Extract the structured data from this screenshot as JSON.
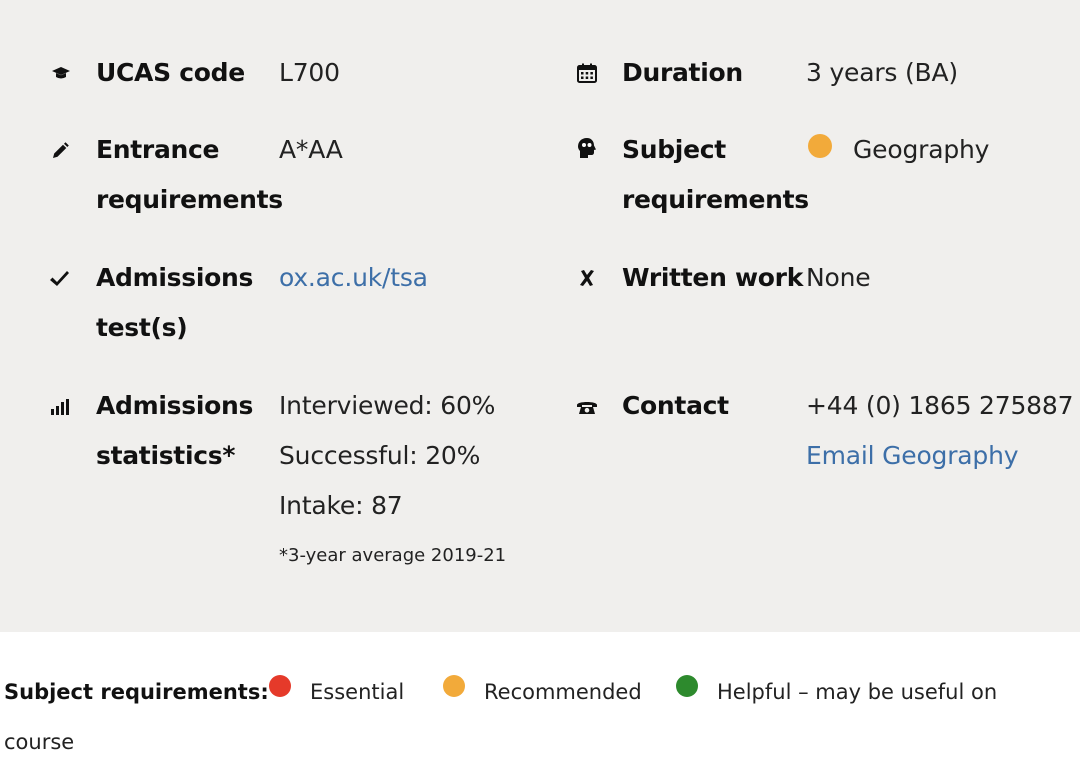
{
  "info": {
    "ucas": {
      "label": "UCAS code",
      "value": "L700",
      "icon": "graduation-cap-icon"
    },
    "entrance": {
      "label_line1": "Entrance",
      "label_line2": "requirements",
      "value": "A*AA",
      "icon": "pencil-icon"
    },
    "admissions_test": {
      "label_line1": "Admissions",
      "label_line2": "test(s)",
      "link": "ox.ac.uk/tsa",
      "icon": "check-icon"
    },
    "statistics": {
      "label_line1": "Admissions",
      "label_line2": "statistics*",
      "interviewed": "Interviewed: 60%",
      "successful": "Successful: 20%",
      "intake": "Intake: 87",
      "note": "*3-year average 2019-21",
      "icon": "bar-chart-icon"
    },
    "duration": {
      "label": "Duration",
      "value": "3 years (BA)",
      "icon": "calendar-icon"
    },
    "subject": {
      "label_line1": "Subject",
      "label_line2": "requirements",
      "value": "Geography",
      "icon": "head-icon"
    },
    "written_work": {
      "label": "Written work",
      "value": "None",
      "icon": "cross-icon"
    },
    "contact": {
      "label": "Contact",
      "phone": "+44 (0) 1865 275887",
      "email_link": "Email Geography",
      "icon": "phone-icon"
    }
  },
  "legend": {
    "title": "Subject requirements:",
    "essential": "Essential",
    "recommended": "Recommended",
    "helpful_line1": "Helpful – may be useful on",
    "helpful_line2": "course"
  },
  "colors": {
    "panel": "#f0efed",
    "link": "#3d6fa8",
    "essential": "#e53a2a",
    "recommended": "#f2aa3a",
    "helpful": "#2d8a2d"
  }
}
